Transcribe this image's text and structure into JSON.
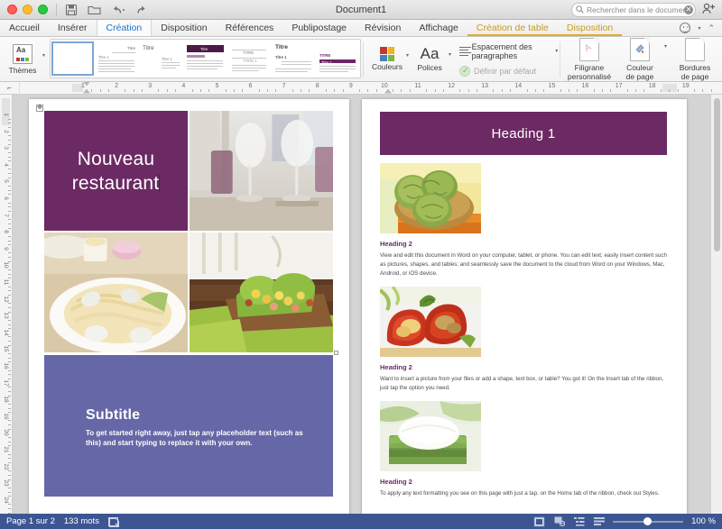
{
  "window": {
    "document_title": "Document1",
    "traffic_lights": [
      "close",
      "minimize",
      "zoom"
    ],
    "quick_access": [
      "save-icon",
      "open-folder-icon",
      "undo-icon",
      "redo-icon"
    ]
  },
  "search": {
    "placeholder": "Rechercher dans le document",
    "icon": "search-icon",
    "clear": "✕"
  },
  "share": {
    "icon": "person-add-icon"
  },
  "tabs": [
    {
      "label": "Accueil",
      "active": false,
      "contextual": false
    },
    {
      "label": "Insérer",
      "active": false,
      "contextual": false
    },
    {
      "label": "Création",
      "active": true,
      "contextual": false
    },
    {
      "label": "Disposition",
      "active": false,
      "contextual": false
    },
    {
      "label": "Références",
      "active": false,
      "contextual": false
    },
    {
      "label": "Publipostage",
      "active": false,
      "contextual": false
    },
    {
      "label": "Révision",
      "active": false,
      "contextual": false
    },
    {
      "label": "Affichage",
      "active": false,
      "contextual": false
    },
    {
      "label": "Création de table",
      "active": false,
      "contextual": true
    },
    {
      "label": "Disposition",
      "active": false,
      "contextual": true
    }
  ],
  "tabbar_right": {
    "smiley": "smiley-icon",
    "caret": "▾",
    "collapse": "⌃"
  },
  "ribbon": {
    "themes": {
      "label": "Thèmes",
      "icon": "themes-icon",
      "caret": "▾"
    },
    "gallery": {
      "name": "themes-gallery",
      "items": [
        {
          "name": "blank-theme",
          "selected": true,
          "title": "",
          "accent": "#ffffff"
        },
        {
          "name": "theme-2",
          "selected": false,
          "title": "TITRE",
          "accent": "#5b5b5b"
        },
        {
          "name": "theme-3",
          "selected": false,
          "title": "Titre",
          "accent": "#6b6b6b"
        },
        {
          "name": "theme-4",
          "selected": false,
          "title": "Titre",
          "accent": "#4b1a48"
        },
        {
          "name": "theme-5",
          "selected": false,
          "title": "Titre",
          "accent": "#5b2b58"
        },
        {
          "name": "theme-6",
          "selected": false,
          "title": "TITRE",
          "accent": "#8d8d8d"
        },
        {
          "name": "theme-7",
          "selected": false,
          "title": "Titre",
          "accent": "#3f3f3f"
        },
        {
          "name": "theme-8",
          "selected": false,
          "title": "TITRE",
          "accent": "#6b2566"
        },
        {
          "name": "theme-9",
          "selected": false,
          "title": "Titre",
          "accent": "#2f2f2f"
        },
        {
          "name": "theme-10",
          "selected": false,
          "title": "Titre",
          "accent": "#2f2f2f"
        }
      ],
      "more": "▸"
    },
    "colors": {
      "label": "Couleurs",
      "icon": "color-swatches-icon",
      "caret": "▾",
      "swatches": [
        "#c0392b",
        "#f0b323",
        "#4a7ebb",
        "#7ab648"
      ]
    },
    "fonts": {
      "label": "Polices",
      "icon": "font-aa-icon",
      "glyph": "Aa",
      "caret": "▾"
    },
    "paragraph_spacing": {
      "label": "Espacement des paragraphes",
      "icon": "paragraph-spacing-icon",
      "caret": "▾"
    },
    "set_default": {
      "label": "Définir par défaut",
      "icon": "check-circle-icon",
      "disabled": true
    },
    "watermark": {
      "label_line1": "Filigrane",
      "label_line2": "personnalisé",
      "icon": "watermark-page-icon"
    },
    "page_color": {
      "label_line1": "Couleur",
      "label_line2": "de page",
      "icon": "page-color-icon",
      "caret": "▾"
    },
    "page_borders": {
      "label_line1": "Bordures",
      "label_line2": "de page",
      "icon": "page-borders-icon"
    }
  },
  "ruler": {
    "corner_icon": "tab-stop-icon",
    "ticks": [
      1,
      2,
      3,
      4,
      5,
      6,
      7,
      8,
      9,
      10,
      11,
      12,
      13,
      14,
      15,
      16,
      17,
      18,
      19
    ]
  },
  "vruler": {
    "ticks": [
      1,
      2,
      3,
      4,
      5,
      6,
      7,
      8,
      9,
      10,
      11,
      12,
      13,
      14,
      15,
      16,
      17,
      18,
      19,
      20,
      21,
      22,
      23,
      24
    ]
  },
  "document": {
    "page1": {
      "title_tile": {
        "text_line1": "Nouveau",
        "text_line2": "restaurant",
        "bg": "#6b2a63",
        "color": "#ffffff"
      },
      "photos": [
        {
          "name": "wine-glasses-photo",
          "alt": "wine glasses on restaurant table"
        },
        {
          "name": "clam-pasta-photo",
          "alt": "spaghetti with clams"
        },
        {
          "name": "shrimp-lettuce-wraps-photo",
          "alt": "shrimp and mango lettuce wraps"
        }
      ],
      "subtitle_block": {
        "bg": "#6667a6",
        "heading": "Subtitle",
        "body": "To get started right away, just tap any placeholder text (such as this) and start typing to replace it with your own."
      }
    },
    "page2": {
      "heading1": {
        "text": "Heading 1",
        "bg": "#6b2a63",
        "color": "#ffffff"
      },
      "sections": [
        {
          "image": {
            "name": "artichokes-photo",
            "alt": "artichokes in a wooden bowl"
          },
          "heading": "Heading 2",
          "body": "View and edit this document in Word on your computer, tablet, or phone. You can edit text; easily insert content such as pictures, shapes, and tables; and seamlessly save the document to the cloud from Word on your Windows, Mac, Android, or iOS device."
        },
        {
          "image": {
            "name": "stuffed-peppers-photo",
            "alt": "stuffed red bell peppers"
          },
          "heading": "Heading 2",
          "body": "Want to insert a picture from your files or add a shape, text box, or table? You got it! On the Insert tab of the ribbon, just tap the option you need."
        },
        {
          "image": {
            "name": "dessert-leaf-photo",
            "alt": "white dessert on a green leaf"
          },
          "heading": "Heading 2",
          "body": "To apply any text formatting you see on this page with just a tap, on the Home tab of the ribbon, check out Styles."
        }
      ],
      "heading_color": "#6b2a63"
    }
  },
  "statusbar": {
    "page_count": "Page 1 sur 2",
    "word_count": "133 mots",
    "proofing_icon": "proofing-check-icon",
    "view_buttons": [
      {
        "name": "print-layout-view",
        "icon": "print-layout-icon",
        "selected": true
      },
      {
        "name": "web-layout-view",
        "icon": "web-layout-icon",
        "selected": false
      },
      {
        "name": "outline-view",
        "icon": "outline-icon",
        "selected": false
      },
      {
        "name": "draft-view",
        "icon": "draft-icon",
        "selected": false
      }
    ],
    "zoom_value": "100 %",
    "zoom_percent": 100,
    "bg": "#3d5692"
  }
}
